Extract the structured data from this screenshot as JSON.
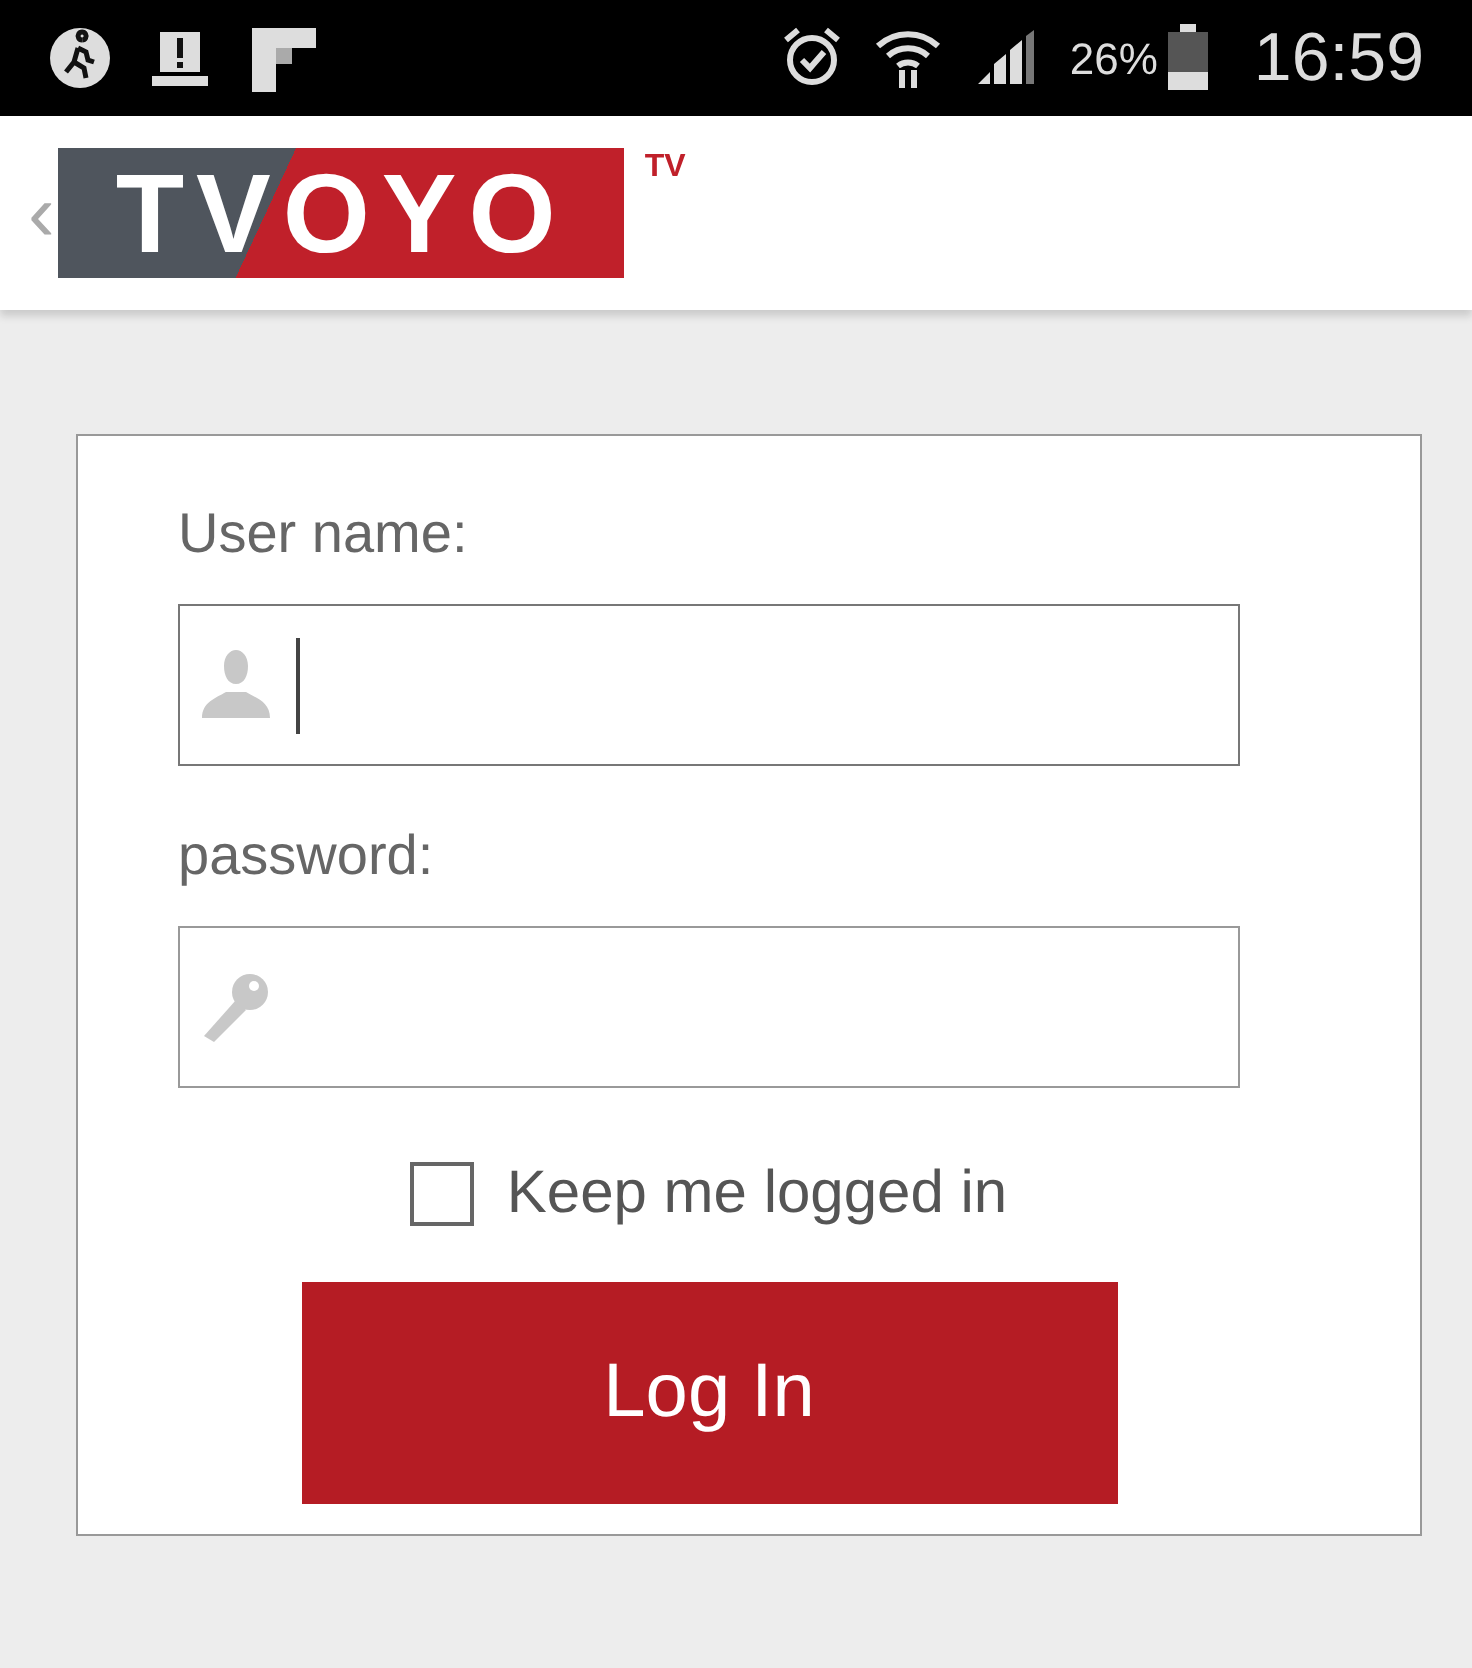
{
  "status_bar": {
    "battery": "26%",
    "time": "16:59"
  },
  "header": {
    "back": "‹",
    "logo": "TVOYO",
    "logo_mark": "TV"
  },
  "form": {
    "fields": [
      {
        "kind": "user",
        "label": "User name:",
        "focused": true
      },
      {
        "kind": "password",
        "label": "password:",
        "focused": false
      }
    ],
    "keep_logged_in": {
      "label": "Keep me logged in",
      "checked": false
    },
    "submit": "Log In"
  }
}
